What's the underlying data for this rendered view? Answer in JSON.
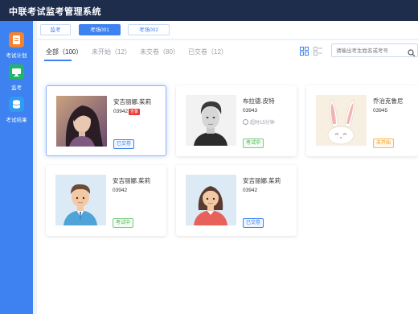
{
  "app": {
    "title": "中联考试监考管理系统"
  },
  "sidebar": {
    "items": [
      {
        "label": "考试计划",
        "icon": "exam-plan-icon",
        "color": "#f5822e"
      },
      {
        "label": "监考",
        "icon": "monitor-icon",
        "color": "#24b36b"
      },
      {
        "label": "考试结果",
        "icon": "database-icon",
        "color": "#2f9bf2"
      }
    ]
  },
  "tabs": [
    {
      "label": "监考"
    },
    {
      "label": "考场001"
    },
    {
      "label": "考场002"
    }
  ],
  "filters": [
    {
      "label": "全部（100）"
    },
    {
      "label": "未开始（12）"
    },
    {
      "label": "未交卷（80）"
    },
    {
      "label": "已交卷（12）"
    }
  ],
  "search": {
    "placeholder": "请输出考生姓名或考号"
  },
  "cards": [
    {
      "name": "安吉丽娜.茱莉",
      "number": "03942",
      "warning": "告警",
      "status": "已交卷",
      "status_kind": "submitted",
      "photo": "woman-photo"
    },
    {
      "name": "布拉德.皮特",
      "number": "03943",
      "timeout": "超时15分钟",
      "status": "考试中",
      "status_kind": "in-progress",
      "photo": "man-photo"
    },
    {
      "name": "乔治克鲁尼",
      "number": "03945",
      "status": "未开始",
      "status_kind": "not-started",
      "photo": "rabbit-illustration"
    },
    {
      "name": "安吉丽娜.茱莉",
      "number": "03942",
      "status": "考试中",
      "status_kind": "in-progress",
      "photo": "male-avatar"
    },
    {
      "name": "安吉丽娜.茱莉",
      "number": "03942",
      "status": "已交卷",
      "status_kind": "submitted",
      "photo": "female-avatar"
    }
  ],
  "colors": {
    "primary": "#3d82f0",
    "topbar": "#1f2d4d",
    "warning": "#e53935",
    "success": "#4caf50",
    "pending": "#f39c12"
  }
}
